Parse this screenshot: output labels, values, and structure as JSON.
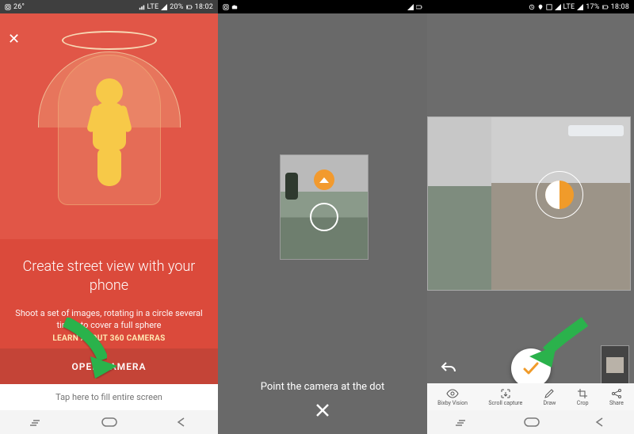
{
  "panel1": {
    "status": {
      "left": "26°",
      "right_net": "LTE",
      "right_battery": "20%",
      "right_time": "18:02"
    },
    "title": "Create street view with your phone",
    "subtitle": "Shoot a set of images, rotating in a circle several times to cover a full sphere",
    "learn_link": "LEARN ABOUT 360 CAMERAS",
    "open_button": "OPEN CAMERA",
    "fill_hint": "Tap here to fill entire screen"
  },
  "panel2": {
    "status": {
      "right_time": ""
    },
    "prompt": "Point the camera at the dot"
  },
  "panel3": {
    "status": {
      "right_net": "LTE",
      "right_battery": "17%",
      "right_time": "18:08"
    },
    "toolbar": {
      "bixby": "Bixby Vision",
      "scroll": "Scroll capture",
      "draw": "Draw",
      "crop": "Crop",
      "share": "Share"
    }
  }
}
